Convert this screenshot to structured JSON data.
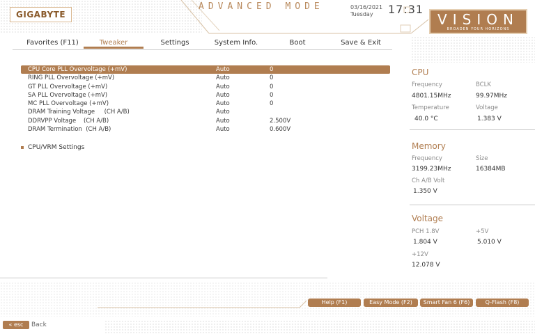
{
  "header": {
    "brand": "GIGABYTE",
    "mode_title": "ADVANCED MODE",
    "date": "03/16/2021",
    "weekday": "Tuesday",
    "time": "17:31",
    "vision_logo": "VISION",
    "vision_tagline": "BROADEN YOUR HORIZONS"
  },
  "tabs": [
    {
      "label": "Favorites (F11)",
      "active": false
    },
    {
      "label": "Tweaker",
      "active": true
    },
    {
      "label": "Settings",
      "active": false
    },
    {
      "label": "System Info.",
      "active": false
    },
    {
      "label": "Boot",
      "active": false
    },
    {
      "label": "Save & Exit",
      "active": false
    }
  ],
  "settings": [
    {
      "name": "CPU Core PLL Overvoltage (+mV)",
      "mode": "Auto",
      "value": "0",
      "selected": true
    },
    {
      "name": "RING PLL Overvoltage (+mV)",
      "mode": "Auto",
      "value": "0",
      "selected": false
    },
    {
      "name": "GT PLL Overvoltage (+mV)",
      "mode": "Auto",
      "value": "0",
      "selected": false
    },
    {
      "name": "SA PLL Overvoltage (+mV)",
      "mode": "Auto",
      "value": "0",
      "selected": false
    },
    {
      "name": "MC PLL Overvoltage (+mV)",
      "mode": "Auto",
      "value": "0",
      "selected": false
    },
    {
      "name": "DRAM Training Voltage     (CH A/B)",
      "mode": "Auto",
      "value": "",
      "selected": false
    },
    {
      "name": "DDRVPP Voltage    (CH A/B)",
      "mode": "Auto",
      "value": "2.500V",
      "selected": false
    },
    {
      "name": "DRAM Termination  (CH A/B)",
      "mode": "Auto",
      "value": "0.600V",
      "selected": false
    }
  ],
  "submenu": {
    "label": "CPU/VRM Settings"
  },
  "panel": {
    "cpu": {
      "title": "CPU",
      "frequency_label": "Frequency",
      "frequency": "4801.15MHz",
      "bclk_label": "BCLK",
      "bclk": "99.97MHz",
      "temp_label": "Temperature",
      "temp": "40.0 °C",
      "voltage_label": "Voltage",
      "voltage": "1.383 V"
    },
    "memory": {
      "title": "Memory",
      "frequency_label": "Frequency",
      "frequency": "3199.23MHz",
      "size_label": "Size",
      "size": "16384MB",
      "volt_label": "Ch A/B Volt",
      "volt": "1.350 V"
    },
    "voltage": {
      "title": "Voltage",
      "pch_label": "PCH 1.8V",
      "pch": "1.804 V",
      "v5_label": "+5V",
      "v5": "5.010 V",
      "v12_label": "+12V",
      "v12": "12.078 V"
    }
  },
  "footer": {
    "buttons": [
      "Help (F1)",
      "Easy Mode (F2)",
      "Smart Fan 6 (F6)",
      "Q-Flash (F8)"
    ],
    "esc_label": "esc",
    "back_label": "Back"
  },
  "colors": {
    "accent": "#b07d50"
  }
}
